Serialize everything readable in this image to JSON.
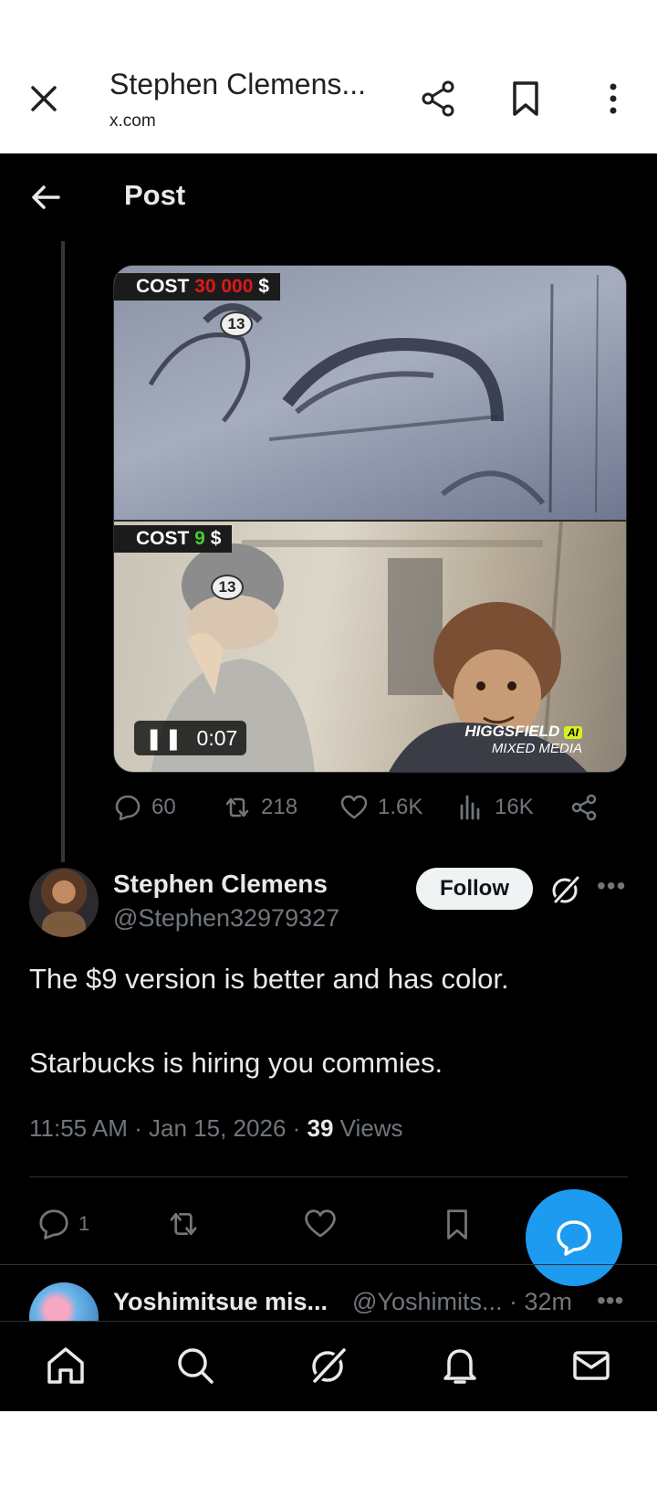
{
  "browser": {
    "title": "Stephen Clemens...",
    "domain": "x.com",
    "icons": [
      "close-icon",
      "share-icon",
      "bookmark-icon",
      "more-vertical-icon"
    ]
  },
  "header": {
    "title": "Post",
    "back_icon": "arrow-left-icon"
  },
  "media": {
    "top_cost_prefix": "COST ",
    "top_cost_value": "30 000",
    "top_cost_suffix": " $",
    "bottom_cost_prefix": "COST ",
    "bottom_cost_value": "9",
    "bottom_cost_suffix": " $",
    "helmet_number": "13",
    "time": "0:07",
    "pause_icon": "pause-icon",
    "watermark_brand": "HIGGSFIELD",
    "watermark_badge": "AI",
    "watermark_sub": "MIXED MEDIA",
    "colors": {
      "cost_red": "#e01818",
      "cost_green": "#3fcf2f"
    }
  },
  "parent_actions": {
    "replies": "60",
    "reposts": "218",
    "likes": "1.6K",
    "views": "16K"
  },
  "post": {
    "author_name": "Stephen Clemens",
    "author_handle": "@Stephen32979327",
    "follow_label": "Follow",
    "text_line1": "The $9 version is better and has color.",
    "text_line2": "Starbucks is hiring you commies.",
    "time": "11:55 AM",
    "date": "Jan 15, 2026",
    "views_count": "39",
    "views_label": "Views",
    "replies": "1"
  },
  "reply_preview": {
    "name": "Yoshimitsue mis...",
    "handle_time": "@Yoshimits... · 32m"
  },
  "bottom_nav": [
    "home-icon",
    "search-icon",
    "grok-icon",
    "notifications-icon",
    "messages-icon"
  ],
  "colors": {
    "accent": "#1d9bf0",
    "muted": "#71767b",
    "text": "#e7e9ea"
  }
}
